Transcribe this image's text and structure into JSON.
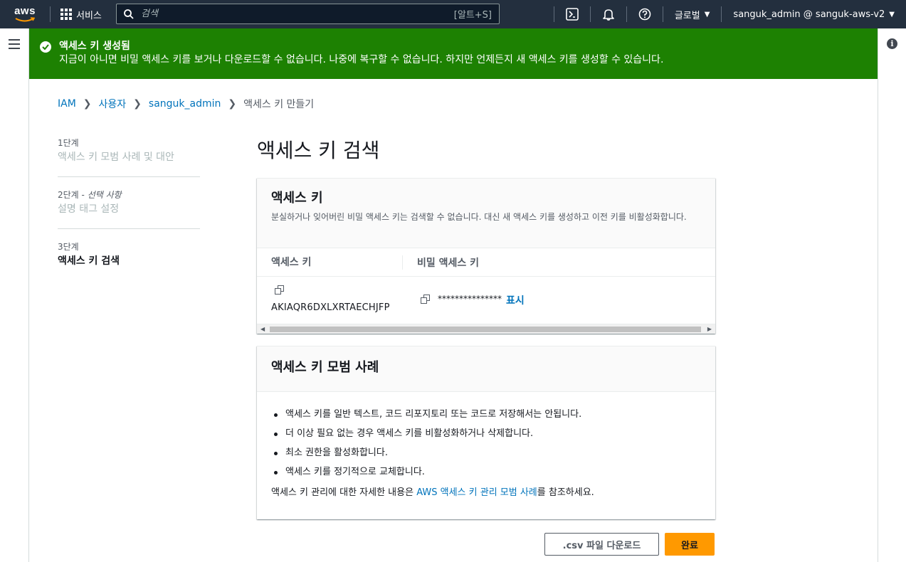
{
  "topnav": {
    "logo_text": "aws",
    "services_label": "서비스",
    "search_placeholder": "검색",
    "search_shortcut": "[알트+S]",
    "region_label": "글로벌",
    "account_label": "sanguk_admin @ sanguk-aws-v2",
    "icons": [
      "cloudshell-icon",
      "bell-icon",
      "help-icon"
    ]
  },
  "flash": {
    "title": "액세스 키 생성됨",
    "message": "지금이 아니면 비밀 액세스 키를 보거나 다운로드할 수 없습니다. 나중에 복구할 수 없습니다. 하지만 언제든지 새 액세스 키를 생성할 수 있습니다.",
    "color": "#1d8102"
  },
  "breadcrumb": {
    "items": [
      "IAM",
      "사용자",
      "sanguk_admin"
    ],
    "current": "액세스 키 만들기"
  },
  "steps": [
    {
      "num": "1단계",
      "optional": "",
      "name": "액세스 키 모범 사례 및 대안"
    },
    {
      "num": "2단계 - ",
      "optional": "선택 사항",
      "name": "설명 태그 설정"
    },
    {
      "num": "3단계",
      "optional": "",
      "name": "액세스 키 검색"
    }
  ],
  "page_title": "액세스 키 검색",
  "access_key_panel": {
    "title": "액세스 키",
    "description": "분실하거나 잊어버린 비밀 액세스 키는 검색할 수 없습니다. 대신 새 액세스 키를 생성하고 이전 키를 비활성화합니다.",
    "col_access_key": "액세스 키",
    "col_secret_key": "비밀 액세스 키",
    "access_key_value": "AKIAQR6DXLXRTAECHJFP",
    "secret_masked": "***************",
    "show_label": "표시"
  },
  "best_practices": {
    "title": "액세스 키 모범 사례",
    "items": [
      "액세스 키를 일반 텍스트, 코드 리포지토리 또는 코드로 저장해서는 안됩니다.",
      "더 이상 필요 없는 경우 액세스 키를 비활성화하거나 삭제합니다.",
      "최소 권한을 활성화합니다.",
      "액세스 키를 정기적으로 교체합니다."
    ],
    "note_prefix": "액세스 키 관리에 대한 자세한 내용은 ",
    "note_link": "AWS 액세스 키 관리 모범 사례",
    "note_suffix": "를 참조하세요."
  },
  "buttons": {
    "csv": ".csv 파일 다운로드",
    "done": "완료"
  },
  "colors": {
    "accent": "#ff9900",
    "link": "#0073bb",
    "nav": "#232f3e"
  }
}
